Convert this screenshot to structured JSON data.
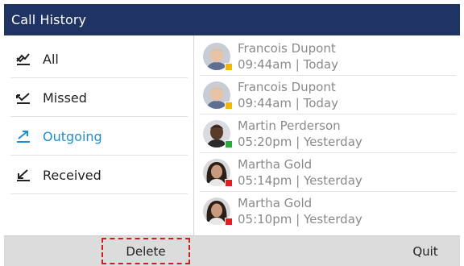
{
  "window": {
    "title": "Call History"
  },
  "sidebar": {
    "items": [
      {
        "label": "All",
        "icon": "all-calls-icon",
        "active": false
      },
      {
        "label": "Missed",
        "icon": "missed-call-icon",
        "active": false
      },
      {
        "label": "Outgoing",
        "icon": "outgoing-call-icon",
        "active": true
      },
      {
        "label": "Received",
        "icon": "received-call-icon",
        "active": false
      }
    ]
  },
  "calls": [
    {
      "name": "Francois Dupont",
      "time": "09:44am | Today",
      "avatar": "man-gray-hair-avatar",
      "status_color": "#f2b705"
    },
    {
      "name": "Francois Dupont",
      "time": "09:44am | Today",
      "avatar": "man-gray-hair-avatar",
      "status_color": "#f2b705"
    },
    {
      "name": "Martin Perderson",
      "time": "05:20pm | Yesterday",
      "avatar": "man-dark-skin-avatar",
      "status_color": "#2eaa3c"
    },
    {
      "name": "Martha Gold",
      "time": "05:14pm | Yesterday",
      "avatar": "woman-dark-hair-avatar",
      "status_color": "#e02020"
    },
    {
      "name": "Martha Gold",
      "time": "05:10pm | Yesterday",
      "avatar": "woman-dark-hair-avatar",
      "status_color": "#e02020"
    }
  ],
  "softkeys": {
    "delete": "Delete",
    "quit": "Quit"
  },
  "colors": {
    "titlebar": "#1f3462",
    "active": "#1e8ed1",
    "softkey_bar": "#dcdcdc",
    "focus_outline": "#cc2020"
  }
}
